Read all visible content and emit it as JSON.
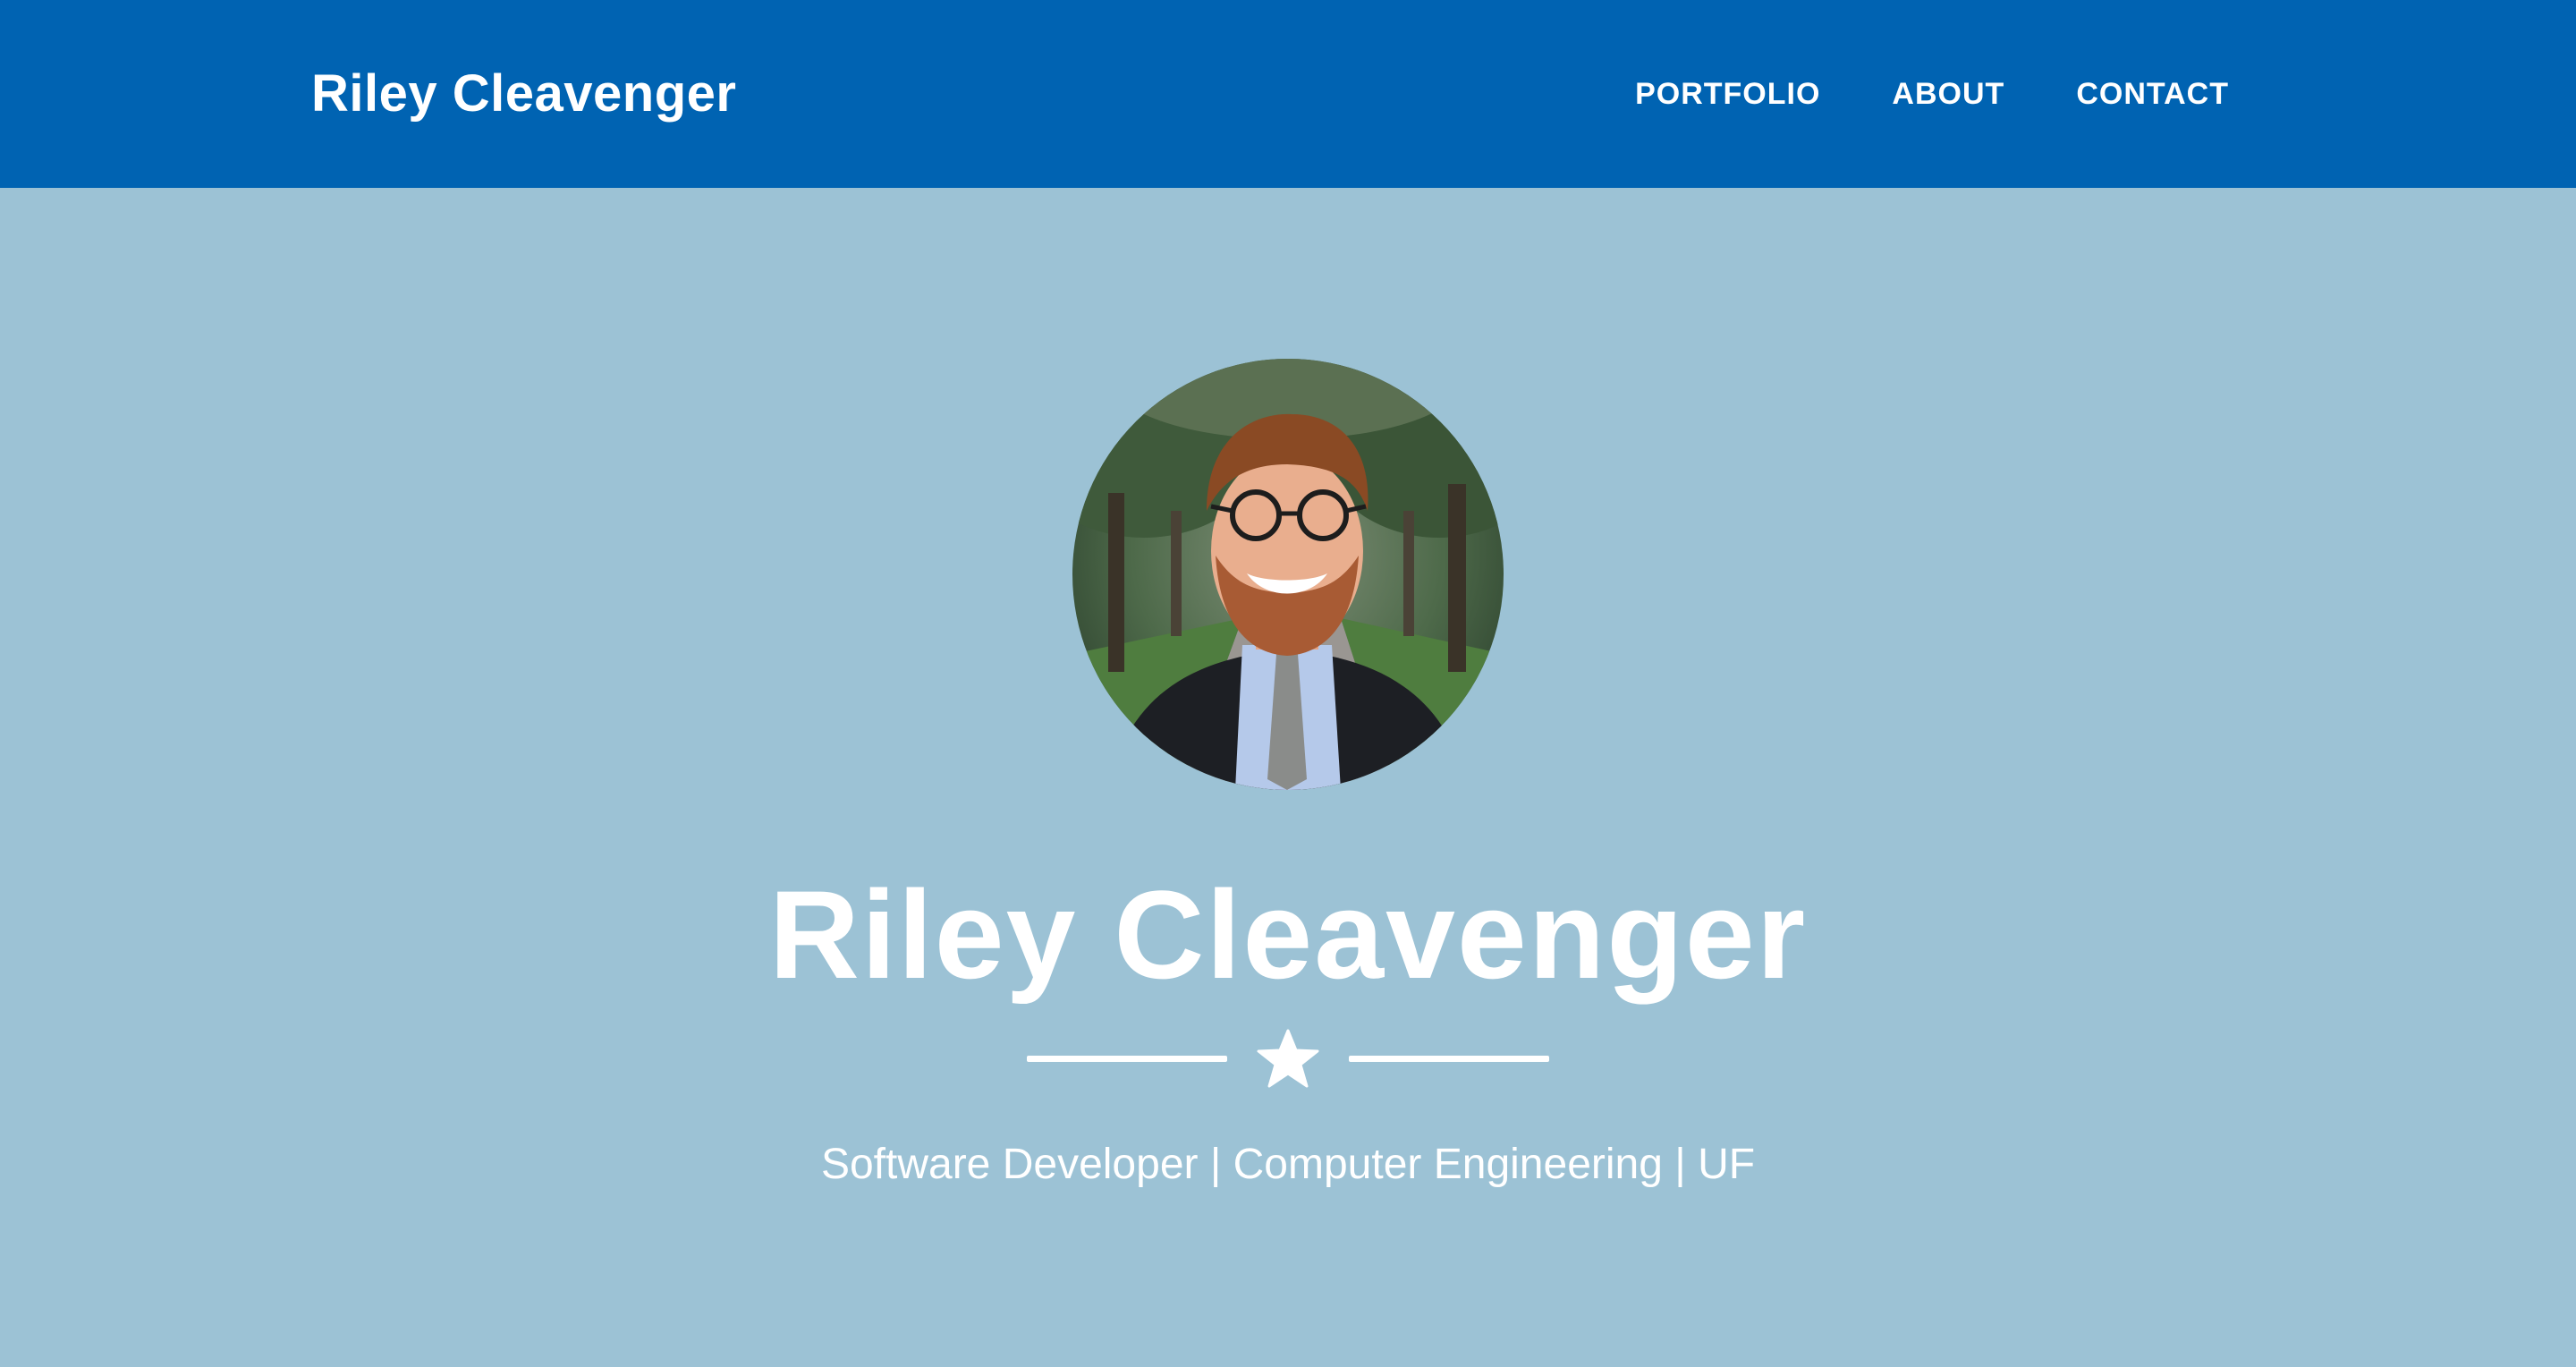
{
  "header": {
    "brand": "Riley Cleavenger",
    "nav": [
      {
        "label": "PORTFOLIO"
      },
      {
        "label": "ABOUT"
      },
      {
        "label": "CONTACT"
      }
    ]
  },
  "hero": {
    "title": "Riley Cleavenger",
    "divider_icon": "star-icon",
    "subtitle": "Software Developer | Computer Engineering | UF"
  },
  "colors": {
    "navbar": "#0063b2",
    "background": "#9cc2d5",
    "text": "#ffffff"
  }
}
